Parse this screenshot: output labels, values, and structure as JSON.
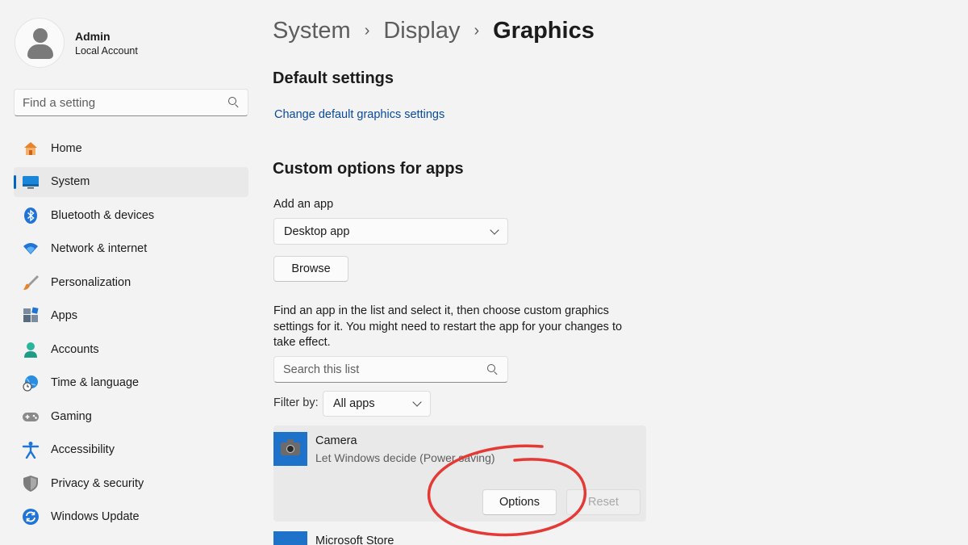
{
  "profile": {
    "name": "Admin",
    "subtitle": "Local Account"
  },
  "search": {
    "placeholder": "Find a setting",
    "icon": "search-icon"
  },
  "sidebar": {
    "items": [
      {
        "label": "Home",
        "icon": "home-icon"
      },
      {
        "label": "System",
        "icon": "system-monitor-icon",
        "active": true
      },
      {
        "label": "Bluetooth & devices",
        "icon": "bluetooth-icon"
      },
      {
        "label": "Network & internet",
        "icon": "wifi-icon"
      },
      {
        "label": "Personalization",
        "icon": "paintbrush-icon"
      },
      {
        "label": "Apps",
        "icon": "apps-icon"
      },
      {
        "label": "Accounts",
        "icon": "person-icon"
      },
      {
        "label": "Time & language",
        "icon": "globe-clock-icon"
      },
      {
        "label": "Gaming",
        "icon": "gamepad-icon"
      },
      {
        "label": "Accessibility",
        "icon": "accessibility-icon"
      },
      {
        "label": "Privacy & security",
        "icon": "shield-icon"
      },
      {
        "label": "Windows Update",
        "icon": "update-sync-icon"
      }
    ]
  },
  "breadcrumb": {
    "items": [
      "System",
      "Display",
      "Graphics"
    ],
    "separator": "›"
  },
  "default_settings": {
    "heading": "Default settings",
    "link": "Change default graphics settings"
  },
  "custom_options": {
    "heading": "Custom options for apps",
    "add_app_label": "Add an app",
    "app_type_value": "Desktop app",
    "browse_label": "Browse",
    "description": "Find an app in the list and select it, then choose custom graphics settings for it. You might need to restart the app for your changes to take effect.",
    "list_search_placeholder": "Search this list",
    "filter_label": "Filter by:",
    "filter_value": "All apps"
  },
  "apps": [
    {
      "name": "Camera",
      "status": "Let Windows decide (Power saving)",
      "options_label": "Options",
      "reset_label": "Reset",
      "icon": "camera-icon"
    },
    {
      "name": "Microsoft Store",
      "icon": "store-icon"
    }
  ],
  "colors": {
    "accent": "#0067c0",
    "link": "#0a4a9c",
    "app_tile": "#1f72c9",
    "annotation": "#e53935"
  }
}
